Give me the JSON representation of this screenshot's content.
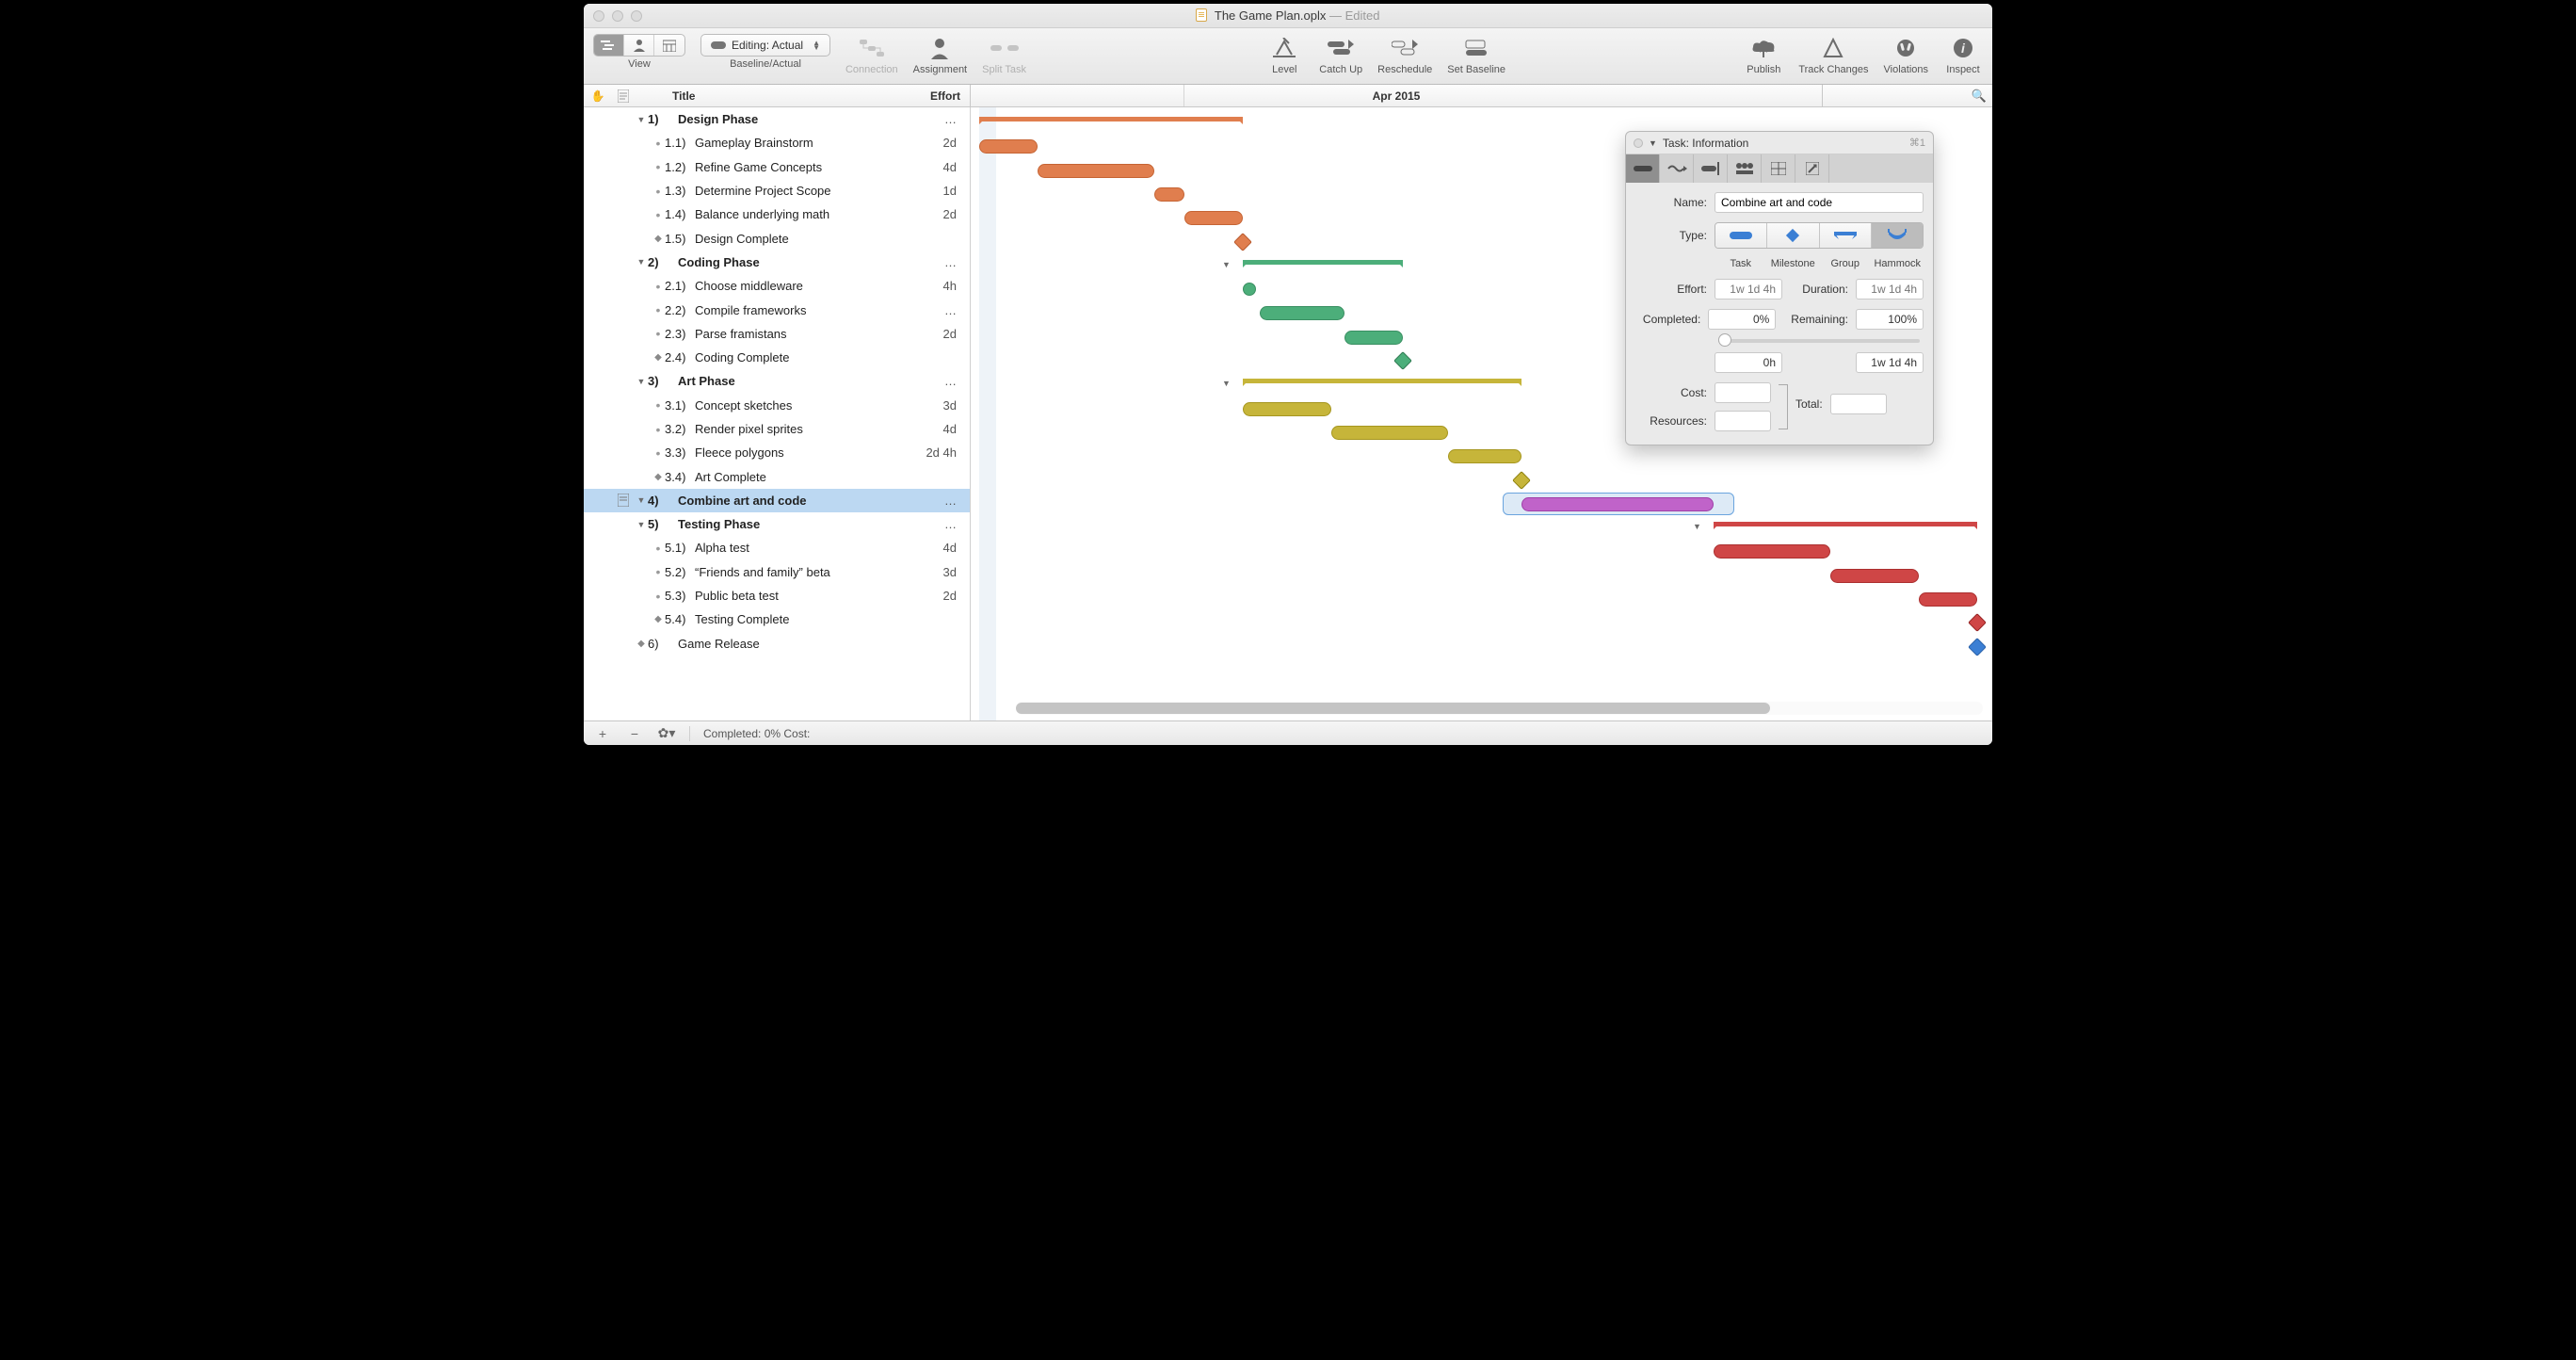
{
  "window": {
    "filename": "The Game Plan.oplx",
    "edited": "Edited"
  },
  "toolbar": {
    "view": "View",
    "baseline_mode": "Editing: Actual",
    "baseline_label": "Baseline/Actual",
    "connection": "Connection",
    "assignment": "Assignment",
    "split_task": "Split Task",
    "level": "Level",
    "catch_up": "Catch Up",
    "reschedule": "Reschedule",
    "set_baseline": "Set Baseline",
    "publish": "Publish",
    "track_changes": "Track Changes",
    "violations": "Violations",
    "inspect": "Inspect"
  },
  "columns": {
    "title": "Title",
    "effort": "Effort"
  },
  "timeline_header": "Apr 2015",
  "outline": [
    {
      "id": "1",
      "name": "Design Phase",
      "group": true,
      "effort": "…",
      "children": [
        {
          "id": "1.1",
          "name": "Gameplay Brainstorm",
          "effort": "2d"
        },
        {
          "id": "1.2",
          "name": "Refine Game Concepts",
          "effort": "4d"
        },
        {
          "id": "1.3",
          "name": "Determine Project Scope",
          "effort": "1d"
        },
        {
          "id": "1.4",
          "name": "Balance underlying math",
          "effort": "2d"
        },
        {
          "id": "1.5",
          "name": "Design Complete",
          "milestone": true,
          "effort": ""
        }
      ]
    },
    {
      "id": "2",
      "name": "Coding Phase",
      "group": true,
      "effort": "…",
      "children": [
        {
          "id": "2.1",
          "name": "Choose middleware",
          "effort": "4h"
        },
        {
          "id": "2.2",
          "name": "Compile frameworks",
          "effort": "…"
        },
        {
          "id": "2.3",
          "name": "Parse framistans",
          "effort": "2d"
        },
        {
          "id": "2.4",
          "name": "Coding Complete",
          "milestone": true,
          "effort": ""
        }
      ]
    },
    {
      "id": "3",
      "name": "Art Phase",
      "group": true,
      "effort": "…",
      "children": [
        {
          "id": "3.1",
          "name": "Concept sketches",
          "effort": "3d"
        },
        {
          "id": "3.2",
          "name": "Render pixel sprites",
          "effort": "4d"
        },
        {
          "id": "3.3",
          "name": "Fleece polygons",
          "effort": "2d 4h"
        },
        {
          "id": "3.4",
          "name": "Art Complete",
          "milestone": true,
          "effort": ""
        }
      ]
    },
    {
      "id": "4",
      "name": "Combine art and code",
      "group": true,
      "selected": true,
      "effort": "…"
    },
    {
      "id": "5",
      "name": "Testing Phase",
      "group": true,
      "effort": "…",
      "children": [
        {
          "id": "5.1",
          "name": "Alpha test",
          "effort": "4d"
        },
        {
          "id": "5.2",
          "name": "“Friends and family” beta",
          "effort": "3d"
        },
        {
          "id": "5.3",
          "name": "Public beta test",
          "effort": "2d"
        },
        {
          "id": "5.4",
          "name": "Testing Complete",
          "milestone": true,
          "effort": ""
        }
      ]
    },
    {
      "id": "6",
      "name": "Game Release",
      "milestone": true,
      "effort": ""
    }
  ],
  "inspector": {
    "title": "Task: Information",
    "shortcut": "⌘1",
    "name_label": "Name:",
    "name_value": "Combine art and code",
    "type_label": "Type:",
    "types": [
      "Task",
      "Milestone",
      "Group",
      "Hammock"
    ],
    "selected_type": "Hammock",
    "effort_label": "Effort:",
    "effort_ph": "1w 1d 4h",
    "duration_label": "Duration:",
    "duration_ph": "1w 1d 4h",
    "completed_label": "Completed:",
    "completed_value": "0%",
    "remaining_label": "Remaining:",
    "remaining_value": "100%",
    "completed_hours": "0h",
    "remaining_hours": "1w 1d 4h",
    "cost_label": "Cost:",
    "resources_label": "Resources:",
    "total_label": "Total:"
  },
  "statusbar": {
    "text": "Completed: 0% Cost:"
  },
  "chart_data": {
    "type": "gantt",
    "time_label": "Apr 2015",
    "tasks": [
      {
        "id": "1",
        "type": "group",
        "color": "orange",
        "start": 0,
        "end": 280
      },
      {
        "id": "1.1",
        "type": "bar",
        "color": "orange",
        "start": 0,
        "end": 62
      },
      {
        "id": "1.2",
        "type": "bar",
        "color": "orange",
        "start": 62,
        "end": 186
      },
      {
        "id": "1.3",
        "type": "bar",
        "color": "orange",
        "start": 186,
        "end": 218
      },
      {
        "id": "1.4",
        "type": "bar",
        "color": "orange",
        "start": 218,
        "end": 280
      },
      {
        "id": "1.5",
        "type": "milestone",
        "color": "orange",
        "at": 280
      },
      {
        "id": "2",
        "type": "group",
        "color": "green",
        "start": 280,
        "end": 450
      },
      {
        "id": "2.1",
        "type": "bar",
        "color": "green",
        "start": 280,
        "end": 298,
        "shape": "circle"
      },
      {
        "id": "2.2",
        "type": "bar",
        "color": "green",
        "start": 298,
        "end": 388
      },
      {
        "id": "2.3",
        "type": "bar",
        "color": "green",
        "start": 388,
        "end": 450
      },
      {
        "id": "2.4",
        "type": "milestone",
        "color": "green",
        "at": 450
      },
      {
        "id": "3",
        "type": "group",
        "color": "olive",
        "start": 280,
        "end": 576
      },
      {
        "id": "3.1",
        "type": "bar",
        "color": "olive",
        "start": 280,
        "end": 374
      },
      {
        "id": "3.2",
        "type": "bar",
        "color": "olive",
        "start": 374,
        "end": 498
      },
      {
        "id": "3.3",
        "type": "bar",
        "color": "olive",
        "start": 498,
        "end": 576
      },
      {
        "id": "3.4",
        "type": "milestone",
        "color": "olive",
        "at": 576
      },
      {
        "id": "4",
        "type": "bar",
        "color": "purple",
        "start": 576,
        "end": 780,
        "selected": true
      },
      {
        "id": "5",
        "type": "group",
        "color": "red",
        "start": 780,
        "end": 1060
      },
      {
        "id": "5.1",
        "type": "bar",
        "color": "red",
        "start": 780,
        "end": 904
      },
      {
        "id": "5.2",
        "type": "bar",
        "color": "red",
        "start": 904,
        "end": 998
      },
      {
        "id": "5.3",
        "type": "bar",
        "color": "red",
        "start": 998,
        "end": 1060
      },
      {
        "id": "5.4",
        "type": "milestone",
        "color": "red",
        "at": 1060
      },
      {
        "id": "6",
        "type": "milestone",
        "color": "blue",
        "at": 1060
      }
    ]
  }
}
